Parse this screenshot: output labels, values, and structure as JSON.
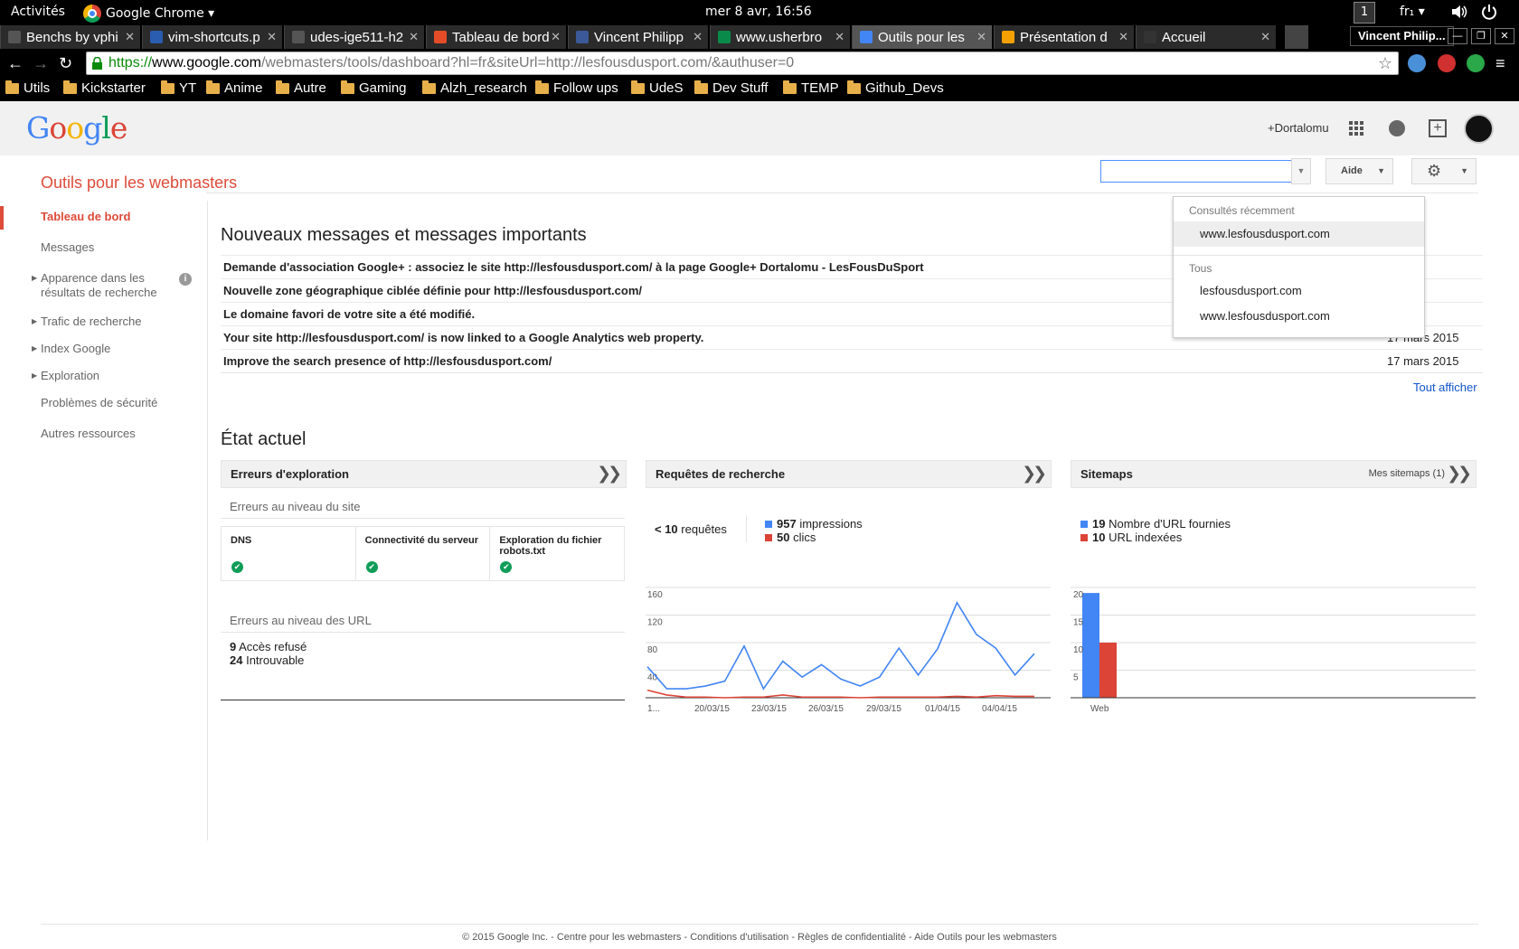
{
  "system": {
    "activities": "Activités",
    "app_menu": "Google Chrome ▾",
    "clock": "mer  8 avr, 16:56",
    "workspace": "1",
    "keyboard": "fr₁ ▾"
  },
  "tabs": [
    {
      "title": "Benchs by vphi",
      "favicon_color": "#555555"
    },
    {
      "title": "vim-shortcuts.p",
      "favicon_color": "#2a5db0"
    },
    {
      "title": "udes-ige511-h2",
      "favicon_color": "#555555"
    },
    {
      "title": "Tableau de bord",
      "favicon_color": "#e34c26"
    },
    {
      "title": "Vincent Philipp",
      "favicon_color": "#3b5998"
    },
    {
      "title": "www.usherbro",
      "favicon_color": "#0a8a4a"
    },
    {
      "title": "Outils pour les",
      "favicon_color": "#4285f4"
    },
    {
      "title": "Présentation d",
      "favicon_color": "#f4a100"
    },
    {
      "title": "Accueil",
      "favicon_color": "#333333"
    }
  ],
  "profile_name": "Vincent Philip...",
  "omnibox": {
    "scheme": "https://",
    "host": "www.google.com",
    "path": "/webmasters/tools/dashboard?hl=fr&siteUrl=http://lesfousdusport.com/&authuser=0"
  },
  "bookmarks": [
    "Utils",
    "Kickstarter",
    "YT",
    "Anime",
    "Autre",
    "Gaming",
    "Alzh_research",
    "Follow ups",
    "UdeS",
    "Dev Stuff",
    "TEMP",
    "Github_Devs"
  ],
  "header": {
    "logo": "Google",
    "user_link": "+Dortalomu",
    "product_title": "Outils pour les webmasters",
    "help_label": "Aide"
  },
  "sidebar": [
    {
      "label": "Tableau de bord",
      "expandable": false,
      "active": true
    },
    {
      "label": "Messages",
      "expandable": false,
      "active": false
    },
    {
      "label": "Apparence dans les résultats de recherche",
      "expandable": true,
      "active": false
    },
    {
      "label": "Trafic de recherche",
      "expandable": true,
      "active": false
    },
    {
      "label": "Index Google",
      "expandable": true,
      "active": false
    },
    {
      "label": "Exploration",
      "expandable": true,
      "active": false
    },
    {
      "label": "Problèmes de sécurité",
      "expandable": false,
      "active": false
    },
    {
      "label": "Autres ressources",
      "expandable": false,
      "active": false
    }
  ],
  "messages": {
    "heading": "Nouveaux messages et messages importants",
    "rows": [
      {
        "text": "Demande d'association Google+ : associez le site http://lesfousdusport.com/ à la page Google+ Dortalomu - LesFousDuSport",
        "date": "2015"
      },
      {
        "text": "Nouvelle zone géographique ciblée définie pour http://lesfousdusport.com/",
        "date": "s 2015"
      },
      {
        "text": "Le domaine favori de votre site a été modifié.",
        "date": "s 2015"
      },
      {
        "text": "Your site http://lesfousdusport.com/ is now linked to a Google Analytics web property.",
        "date": "17 mars 2015"
      },
      {
        "text": "Improve the search presence of http://lesfousdusport.com/",
        "date": "17 mars 2015"
      }
    ],
    "show_all": "Tout afficher"
  },
  "status": {
    "heading": "État actuel",
    "crawl": {
      "title": "Erreurs d'exploration",
      "site_level": "Erreurs au niveau du site",
      "checks": [
        "DNS",
        "Connectivité du serveur",
        "Exploration du fichier robots.txt"
      ],
      "url_level": "Erreurs au niveau des URL",
      "url_errors": [
        {
          "count": "9",
          "label": "Accès refusé"
        },
        {
          "count": "24",
          "label": "Introuvable"
        }
      ]
    },
    "search": {
      "title": "Requêtes de recherche",
      "queries_count": "< 10",
      "queries_label": "requêtes",
      "impressions_count": "957",
      "impressions_label": "impressions",
      "clicks_count": "50",
      "clicks_label": "clics"
    },
    "sitemaps": {
      "title": "Sitemaps",
      "link": "Mes sitemaps (1)",
      "submitted_count": "19",
      "submitted_label": "Nombre d'URL fournies",
      "indexed_count": "10",
      "indexed_label": "URL indexées"
    }
  },
  "chart_data": [
    {
      "type": "line",
      "x_tick_labels": [
        "1...",
        "20/03/15",
        "23/03/15",
        "26/03/15",
        "29/03/15",
        "01/04/15",
        "04/04/15"
      ],
      "ylim": [
        0,
        160
      ],
      "yticks": [
        40,
        80,
        120,
        160
      ],
      "series": [
        {
          "name": "impressions",
          "color": "#4285f4",
          "values": [
            45,
            13,
            13,
            17,
            24,
            75,
            13,
            53,
            30,
            48,
            27,
            17,
            30,
            72,
            33,
            71,
            138,
            92,
            72,
            33,
            64
          ]
        },
        {
          "name": "clics",
          "color": "#db4437",
          "values": [
            11,
            4,
            1,
            1,
            0,
            1,
            1,
            4,
            1,
            1,
            1,
            0,
            1,
            1,
            1,
            1,
            2,
            1,
            3,
            2,
            2
          ]
        }
      ]
    },
    {
      "type": "bar",
      "categories": [
        "Web"
      ],
      "ylim": [
        0,
        20
      ],
      "yticks": [
        5,
        10,
        15,
        20
      ],
      "series": [
        {
          "name": "Nombre d'URL fournies",
          "color": "#4285f4",
          "values": [
            19
          ]
        },
        {
          "name": "URL indexées",
          "color": "#db4437",
          "values": [
            10
          ]
        }
      ]
    }
  ],
  "site_menu": {
    "recent_label": "Consultés récemment",
    "recent": [
      "www.lesfousdusport.com"
    ],
    "all_label": "Tous",
    "all": [
      "lesfousdusport.com",
      "www.lesfousdusport.com"
    ]
  },
  "footer": "© 2015 Google Inc. - Centre pour les webmasters - Conditions d'utilisation - Règles de confidentialité - Aide Outils pour les webmasters"
}
